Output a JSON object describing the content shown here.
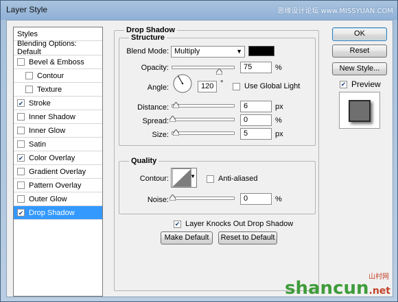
{
  "window": {
    "title": "Layer Style",
    "watermark_top": "思缘设计论坛 www.MISSYUAN.COM",
    "watermark_bottom_main": "shancun",
    "watermark_bottom_sub": ".net",
    "watermark_bottom_cn": "山村网"
  },
  "styles_list": {
    "header": "Styles",
    "blending": "Blending Options: Default",
    "items": [
      {
        "label": "Bevel & Emboss",
        "checked": false,
        "indent": false
      },
      {
        "label": "Contour",
        "checked": false,
        "indent": true
      },
      {
        "label": "Texture",
        "checked": false,
        "indent": true
      },
      {
        "label": "Stroke",
        "checked": true,
        "indent": false
      },
      {
        "label": "Inner Shadow",
        "checked": false,
        "indent": false
      },
      {
        "label": "Inner Glow",
        "checked": false,
        "indent": false
      },
      {
        "label": "Satin",
        "checked": false,
        "indent": false
      },
      {
        "label": "Color Overlay",
        "checked": true,
        "indent": false
      },
      {
        "label": "Gradient Overlay",
        "checked": false,
        "indent": false
      },
      {
        "label": "Pattern Overlay",
        "checked": false,
        "indent": false
      },
      {
        "label": "Outer Glow",
        "checked": false,
        "indent": false
      },
      {
        "label": "Drop Shadow",
        "checked": true,
        "indent": false,
        "selected": true
      }
    ]
  },
  "drop_shadow": {
    "title": "Drop Shadow",
    "structure_title": "Structure",
    "blend_mode_label": "Blend Mode:",
    "blend_mode_value": "Multiply",
    "shadow_color": "#000000",
    "opacity_label": "Opacity:",
    "opacity_value": "75",
    "opacity_fraction": 0.75,
    "percent": "%",
    "angle_label": "Angle:",
    "angle_value": "120",
    "degree": "°",
    "use_global_light": "Use Global Light",
    "distance_label": "Distance:",
    "distance_value": "6",
    "spread_label": "Spread:",
    "spread_value": "0",
    "size_label": "Size:",
    "size_value": "5",
    "px": "px",
    "quality_title": "Quality",
    "contour_label": "Contour:",
    "anti_aliased": "Anti-aliased",
    "noise_label": "Noise:",
    "noise_value": "0",
    "layer_knocks_out": "Layer Knocks Out Drop Shadow",
    "make_default": "Make Default",
    "reset_default": "Reset to Default"
  },
  "buttons": {
    "ok": "OK",
    "reset": "Reset",
    "new_style": "New Style...",
    "preview": "Preview"
  },
  "colors": {
    "selection": "#3399ff",
    "preview_swatch": "#6f6f6f"
  }
}
